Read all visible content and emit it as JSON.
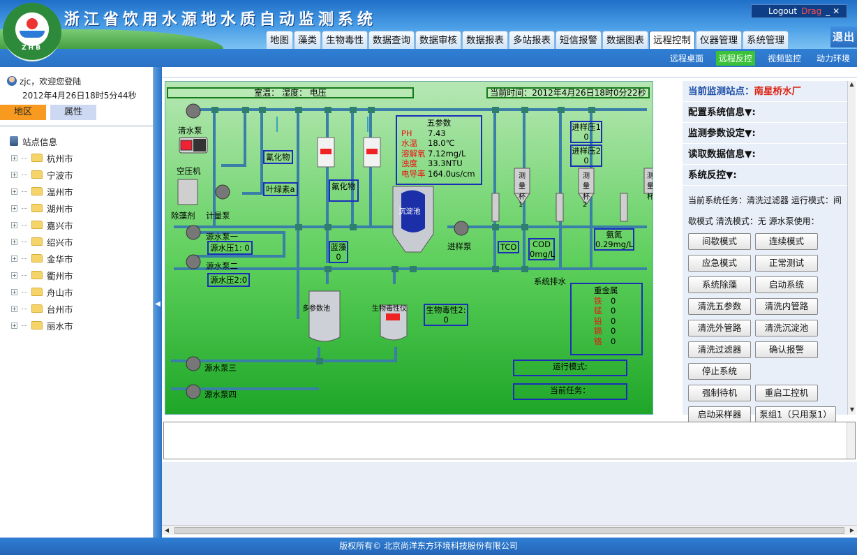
{
  "app": {
    "title": "浙江省饮用水源地水质自动监测系统",
    "logo_text": "ZHB",
    "logout_label": "Logout",
    "drag_label": "Drag",
    "win_controls": "_ ✕",
    "exit_label": "退出"
  },
  "topnav": [
    {
      "label": "地图",
      "active": false
    },
    {
      "label": "藻类",
      "active": false
    },
    {
      "label": "生物毒性",
      "active": false
    },
    {
      "label": "数据查询",
      "active": false
    },
    {
      "label": "数据审核",
      "active": false
    },
    {
      "label": "数据报表",
      "active": false
    },
    {
      "label": "多站报表",
      "active": false
    },
    {
      "label": "短信报警",
      "active": false
    },
    {
      "label": "数据图表",
      "active": false
    },
    {
      "label": "远程控制",
      "active": true
    },
    {
      "label": "仪器管理",
      "active": false
    },
    {
      "label": "系统管理",
      "active": false
    }
  ],
  "subnav": [
    {
      "label": "远程桌面",
      "active": false
    },
    {
      "label": "远程反控",
      "active": true
    },
    {
      "label": "视频监控",
      "active": false
    },
    {
      "label": "动力环境",
      "active": false
    }
  ],
  "sidebar": {
    "welcome": "zjc，欢迎您登陆",
    "datetime": "2012年4月26日18时5分44秒",
    "tab_region": "地区",
    "tab_attr": "属性",
    "tree_root": "站点信息",
    "cities": [
      "杭州市",
      "宁波市",
      "温州市",
      "湖州市",
      "嘉兴市",
      "绍兴市",
      "金华市",
      "衢州市",
      "舟山市",
      "台州市",
      "丽水市"
    ]
  },
  "schematic": {
    "env_header": "室温：  湿度：  电压",
    "current_time": "当前时间：2012年4月26日18时0分22秒",
    "labels": {
      "clean_pump": "清水泵",
      "air_compressor": "空压机",
      "algaecide": "除藻剂",
      "metering_pump": "计量泵",
      "source_pump1": "源水泵一",
      "source_pump2": "源水泵二",
      "source_pump3": "源水泵三",
      "source_pump4": "源水泵四",
      "sediment_tank": "沉淀池",
      "sample_pump": "进样泵",
      "multi_param": "多参数池",
      "bio_toxicity_instr": "生物毒性仪",
      "drain": "系统排水",
      "cup1": "测量杯1",
      "cup2": "测量杯2",
      "cup3": "测量杯"
    },
    "boxes": {
      "cyanide": "氰化物",
      "chlorophyll": "叶绿素a",
      "fluoride": "氟化物",
      "source_pressure1": "源水压1: 0",
      "source_pressure2": "源水压2:0",
      "blue_algae_label": "蓝藻",
      "blue_algae_value": "0",
      "inlet_pressure1_label": "进样压1",
      "inlet_pressure1_value": "0",
      "inlet_pressure2_label": "进样压2",
      "inlet_pressure2_value": "0",
      "tco": "TCO",
      "cod_label": "COD",
      "cod_value": "0mg/L",
      "ammonia_label": "氨氮",
      "ammonia_value": "0.29mg/L",
      "bio_toxicity_label": "生物毒性2:",
      "bio_toxicity_value": "0",
      "run_mode": "运行模式:",
      "current_task": "当前任务："
    },
    "five_params": {
      "title": "五参数",
      "rows": [
        {
          "name": "PH",
          "value": "7.43"
        },
        {
          "name": "水温",
          "value": "18.0℃"
        },
        {
          "name": "溶解氧",
          "value": "7.12mg/L"
        },
        {
          "name": "浊度",
          "value": "33.3NTU"
        },
        {
          "name": "电导率",
          "value": "164.0us/cm"
        }
      ]
    },
    "heavy_metals": {
      "title": "重金属",
      "rows": [
        {
          "name": "铁",
          "value": "0"
        },
        {
          "name": "锰",
          "value": "0"
        },
        {
          "name": "铅",
          "value": "0"
        },
        {
          "name": "镉",
          "value": "0"
        },
        {
          "name": "铬",
          "value": "0"
        }
      ]
    }
  },
  "control": {
    "station_label": "当前监测站点：",
    "station_name": "南星桥水厂",
    "sections": [
      "配置系统信息▼:",
      "监测参数设定▼:",
      "读取数据信息▼:",
      "系统反控▼:"
    ],
    "task_line1": "当前系统任务：清洗过滤器 运行模式：间",
    "task_line2": "歇模式 清洗模式：无 源水泵使用：",
    "buttons": [
      "间歇模式",
      "连续模式",
      "应急模式",
      "正常测试",
      "系统除藻",
      "启动系统",
      "清洗五参数",
      "清洗内管路",
      "清洗外管路",
      "清洗沉淀池",
      "清洗过滤器",
      "确认报警",
      "停止系统",
      "",
      "强制待机",
      "重启工控机",
      "启动采样器",
      "泵组1（只用泵1）"
    ]
  },
  "footer": "版权所有© 北京尚洋东方环境科技股份有限公司"
}
